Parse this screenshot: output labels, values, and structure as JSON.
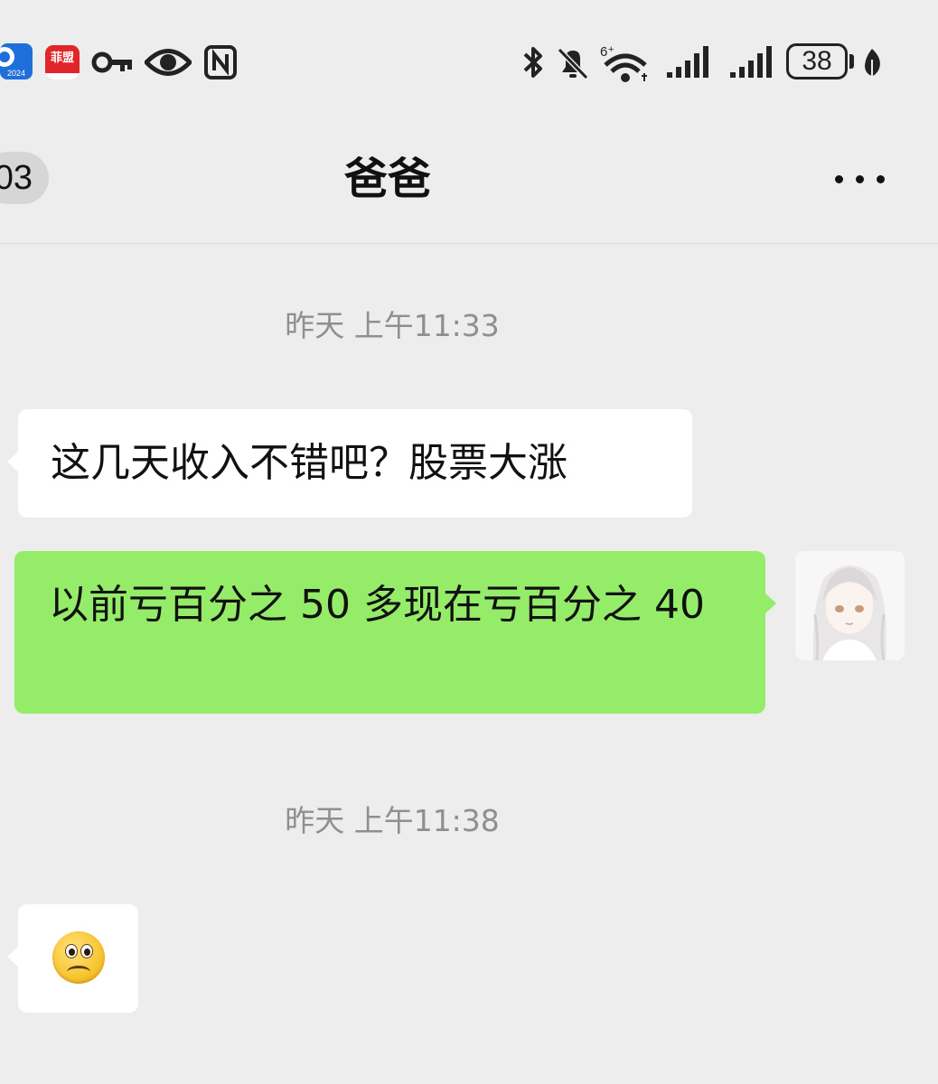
{
  "status_bar": {
    "app_badge_year": "2024",
    "app_badge_red_text": "菲盟儿",
    "battery_percent": "38",
    "wifi_badge": "6"
  },
  "nav": {
    "unread_count": "03",
    "title": "爸爸"
  },
  "messages": [
    {
      "type": "timestamp",
      "text": "昨天 上午11:33"
    },
    {
      "type": "text",
      "direction": "incoming",
      "text": "这几天收入不错吧？股票大涨"
    },
    {
      "type": "text",
      "direction": "outgoing",
      "text": "以前亏百分之 50 多现在亏百分之 40"
    },
    {
      "type": "timestamp",
      "text": "昨天 上午11:38"
    },
    {
      "type": "emoji",
      "direction": "incoming",
      "emoji": "frowning-face"
    }
  ],
  "colors": {
    "background": "#ededed",
    "outgoing_bubble": "#95ec69",
    "incoming_bubble": "#ffffff",
    "timestamp_text": "#8f8f8f"
  }
}
